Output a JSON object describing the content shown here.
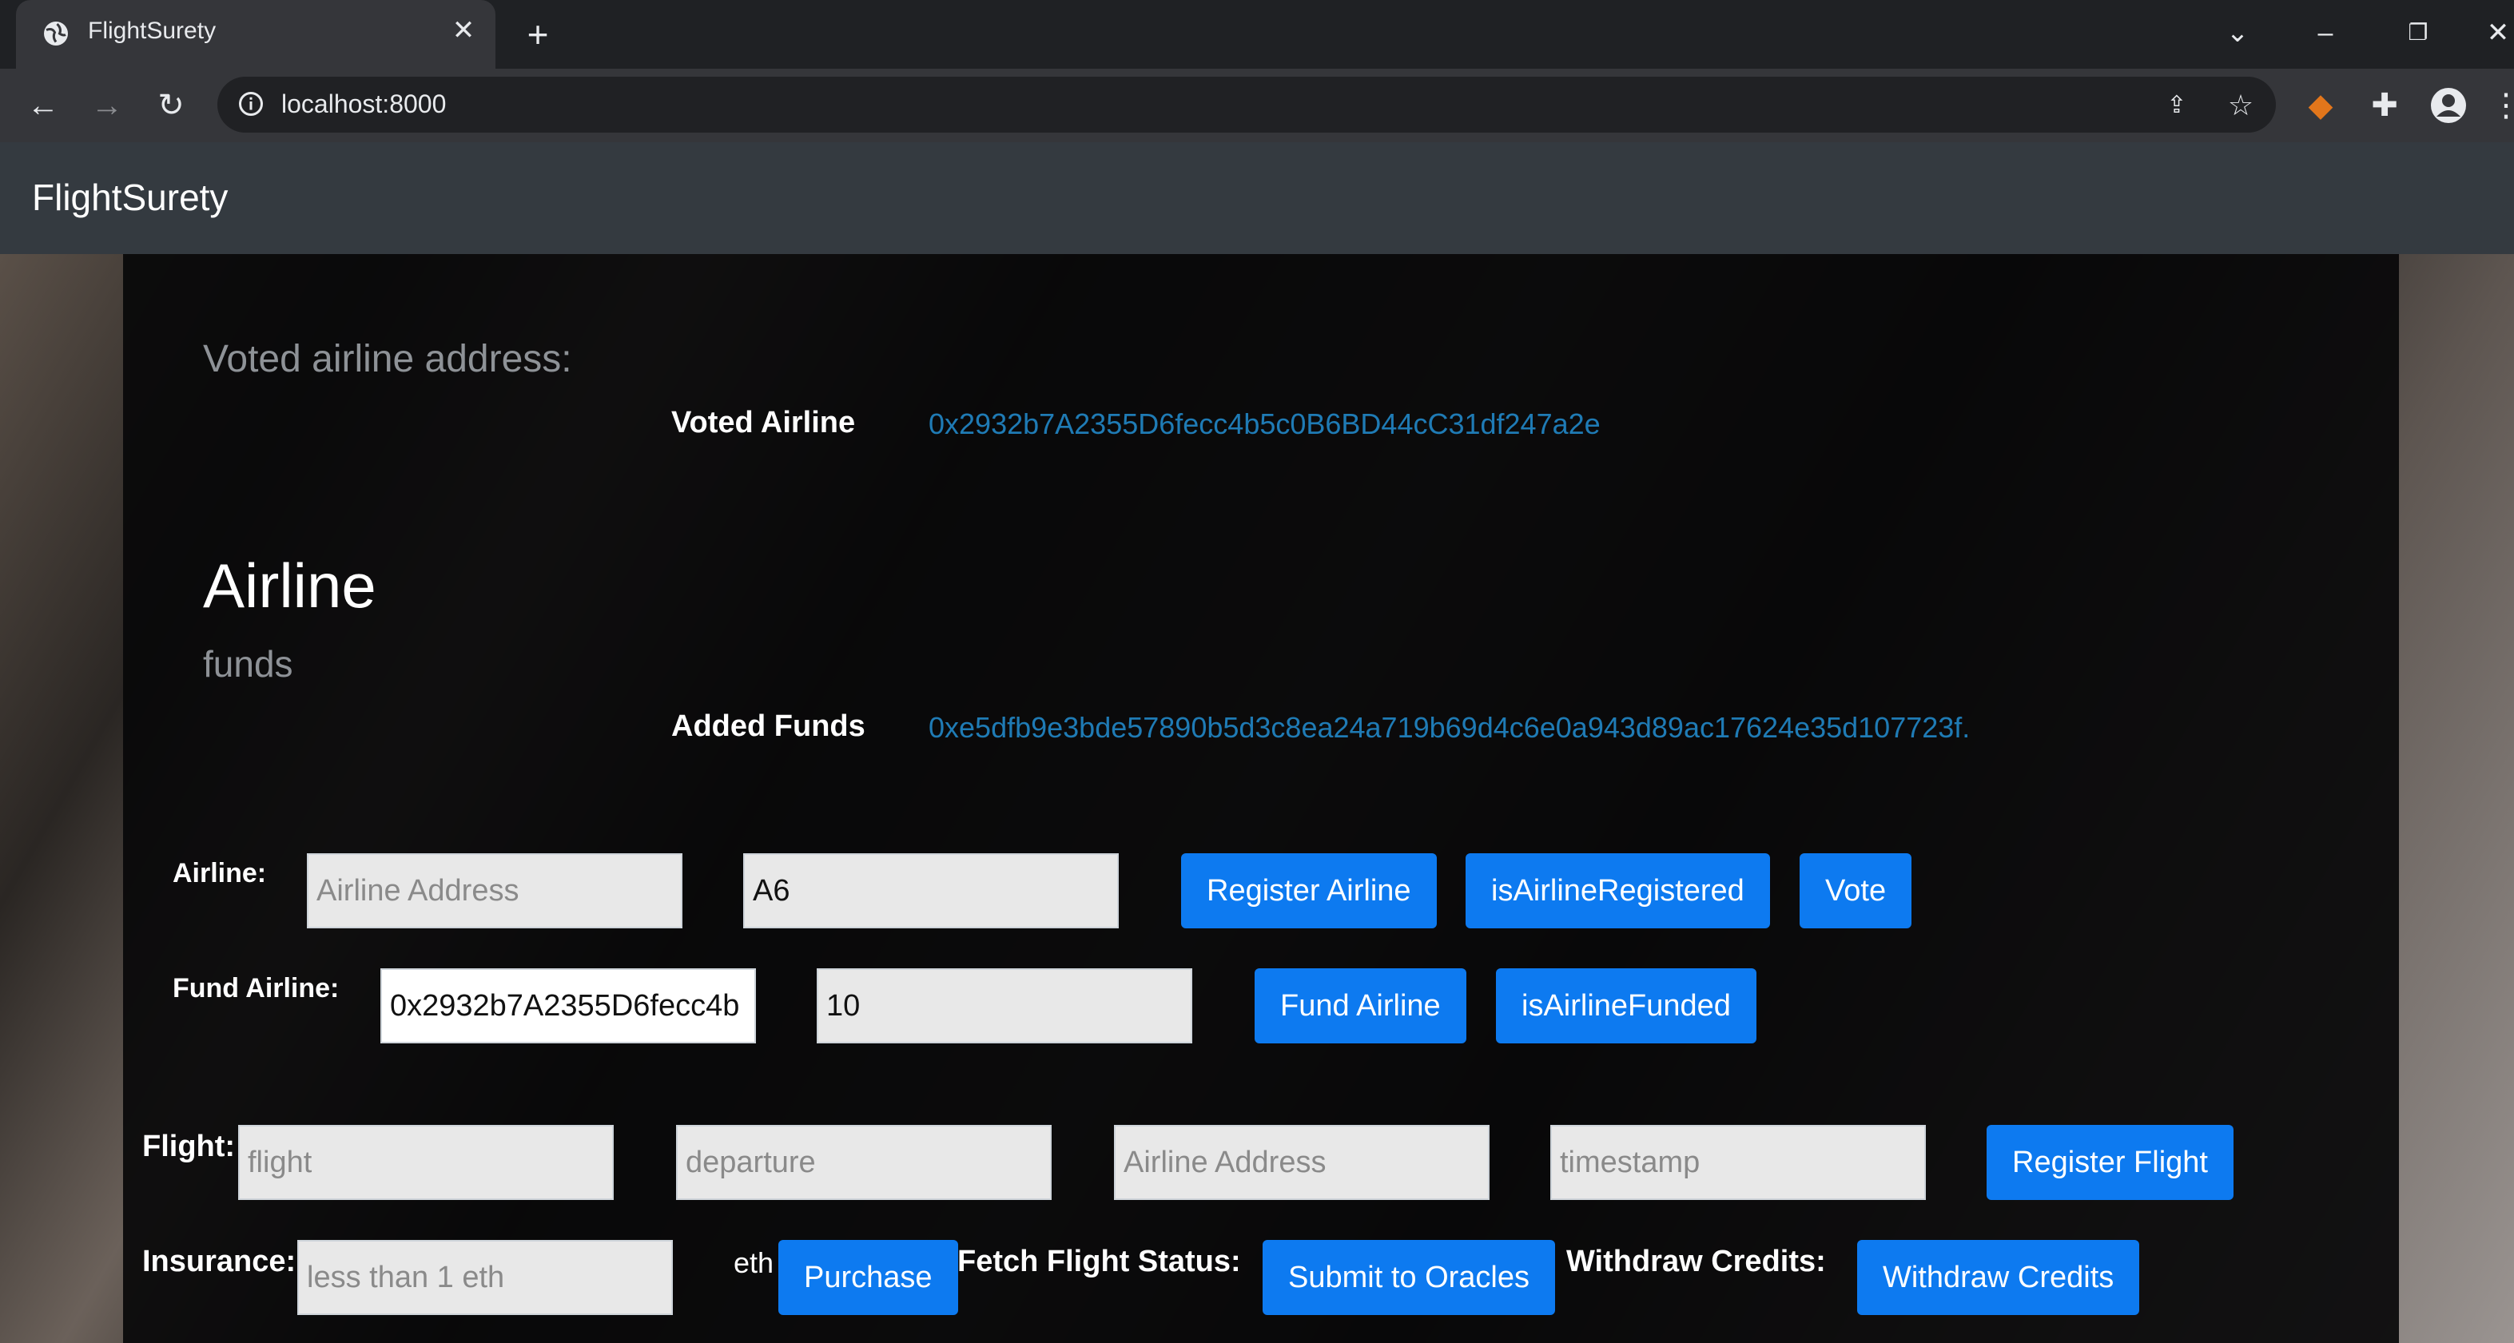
{
  "browser": {
    "tab_title": "FlightSurety",
    "url": "localhost:8000"
  },
  "navbar": {
    "brand": "FlightSurety"
  },
  "voted": {
    "section_label": "Voted airline address:",
    "label": "Voted Airline",
    "value": "0x2932b7A2355D6fecc4b5c0B6BD44cC31df247a2e"
  },
  "airline_funds": {
    "heading": "Airline",
    "subheading": "funds",
    "label": "Added Funds",
    "value": "0xe5dfb9e3bde57890b5d3c8ea24a719b69d4c6e0a943d89ac17624e35d107723f."
  },
  "airline_form": {
    "label": "Airline:",
    "address_placeholder": "Airline Address",
    "name_value": "A6",
    "register_button": "Register Airline",
    "is_registered_button": "isAirlineRegistered",
    "vote_button": "Vote"
  },
  "fund_form": {
    "label": "Fund Airline:",
    "address_value": "0x2932b7A2355D6fecc4b",
    "amount_value": "10",
    "fund_button": "Fund Airline",
    "is_funded_button": "isAirlineFunded"
  },
  "flight_form": {
    "label": "Flight:",
    "flight_placeholder": "flight",
    "departure_placeholder": "departure",
    "address_placeholder": "Airline Address",
    "timestamp_placeholder": "timestamp",
    "register_button": "Register Flight"
  },
  "insurance_form": {
    "label": "Insurance:",
    "amount_placeholder": "less than 1 eth",
    "unit": "eth",
    "purchase_button": "Purchase",
    "fetch_label": "Fetch Flight Status:",
    "submit_button": "Submit to Oracles",
    "withdraw_label": "Withdraw Credits:",
    "withdraw_button": "Withdraw Credits"
  },
  "colors": {
    "primary_button": "#0d7af0",
    "link_value": "#1f7bb5",
    "navbar": "#343a40"
  }
}
